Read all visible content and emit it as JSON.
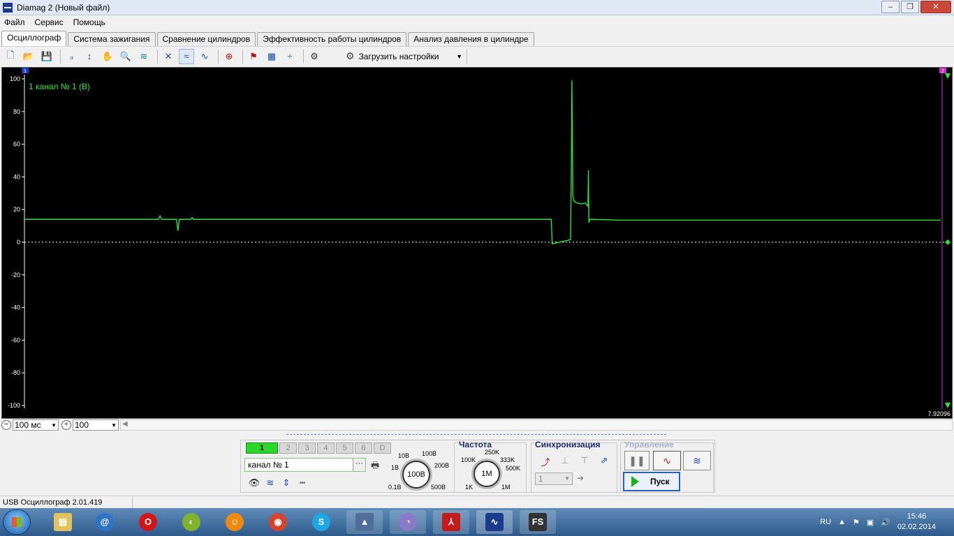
{
  "window": {
    "title": "Diamag 2 (Новый файл)"
  },
  "menu": [
    "Файл",
    "Сервис",
    "Помощь"
  ],
  "tabs": [
    "Осциллограф",
    "Система зажигания",
    "Сравнение цилиндров",
    "Эффективность работы цилиндров",
    "Анализ давления в цилиндре"
  ],
  "toolbar": {
    "load_settings_label": "Загрузить настройки"
  },
  "scope": {
    "channel_label": "1  канал № 1 (В)",
    "marker_left": "1",
    "marker_right": "2",
    "time_readout": "7.92096",
    "trace_color": "#28e632"
  },
  "chart_data": {
    "type": "line",
    "title": "",
    "xlabel": "",
    "ylabel": "",
    "ylim": [
      -100,
      100
    ],
    "yticks": [
      "100",
      "80",
      "60",
      "40",
      "20",
      "0",
      "-20",
      "-40",
      "-60",
      "-80",
      "-100"
    ],
    "grid": false,
    "series": [
      {
        "name": "канал № 1 (В)",
        "x": [
          0,
          14.6,
          14.8,
          15,
          16.6,
          16.75,
          16.9,
          17.1,
          18.15,
          18.3,
          18.45,
          57.5,
          57.6,
          59.6,
          59.7,
          59.75,
          59.85,
          60,
          60.3,
          60.7,
          61.2,
          61.5,
          61.55,
          61.6,
          61.7,
          62,
          65,
          100
        ],
        "y": [
          14,
          14,
          16,
          14,
          14,
          7,
          14,
          14,
          14,
          15,
          14,
          14,
          -1,
          1.5,
          50,
          99,
          28,
          25,
          24,
          23.5,
          24,
          22,
          44,
          12,
          14,
          14,
          13.5,
          13.5
        ]
      }
    ]
  },
  "zoom": {
    "time_value": "100 мс",
    "amp_value": "100"
  },
  "channels": {
    "buttons": [
      "1",
      "2",
      "3",
      "4",
      "5",
      "6",
      "D"
    ],
    "name": "канал № 1"
  },
  "voltage": {
    "value": "100В",
    "labels": [
      "10В",
      "100В",
      "1В",
      "200В",
      "0.1В",
      "500В"
    ]
  },
  "frequency": {
    "title": "Частота",
    "value": "1M",
    "labels": [
      "250K",
      "100K",
      "333K",
      "500K",
      "1K",
      "1M"
    ]
  },
  "sync": {
    "title": "Синхронизация",
    "select_value": "1"
  },
  "control": {
    "title": "Управление",
    "start_label": "Пуск"
  },
  "status": {
    "text": "USB Осциллограф  2.01.419"
  },
  "taskbar": {
    "lang": "RU",
    "time": "15:46",
    "date": "02.02.2014"
  }
}
